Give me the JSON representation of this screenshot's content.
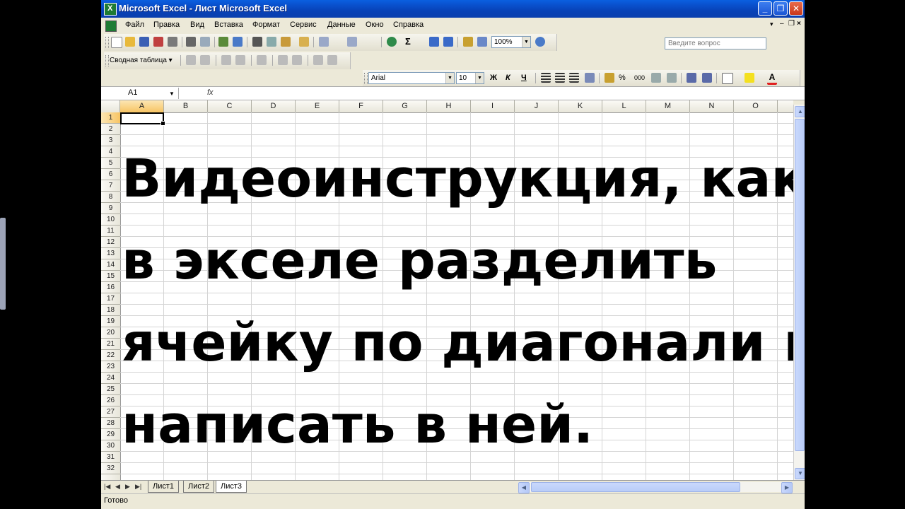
{
  "window": {
    "title": "Microsoft Excel - Лист Microsoft Excel",
    "min_label": "_",
    "max_label": "❐",
    "close_label": "✕"
  },
  "menu": {
    "items": [
      "Файл",
      "Правка",
      "Вид",
      "Вставка",
      "Формат",
      "Сервис",
      "Данные",
      "Окно",
      "Справка"
    ],
    "help_placeholder": "Введите вопрос"
  },
  "toolbar": {
    "zoom": "100%",
    "pivot_label": "Сводная таблица ▾",
    "font": "Arial",
    "font_size": "10",
    "bold": "Ж",
    "italic": "К",
    "underline": "Ч",
    "percent": "%",
    "thousands": "000",
    "sum": "Σ"
  },
  "formula_bar": {
    "name_box": "A1",
    "fx": "fx",
    "formula": ""
  },
  "sheet": {
    "columns": [
      "A",
      "B",
      "C",
      "D",
      "E",
      "F",
      "G",
      "H",
      "I",
      "J",
      "K",
      "L",
      "M",
      "N",
      "O"
    ],
    "rows": [
      "1",
      "2",
      "3",
      "4",
      "5",
      "6",
      "7",
      "8",
      "9",
      "10",
      "11",
      "12",
      "13",
      "14",
      "15",
      "16",
      "17",
      "18",
      "19",
      "20",
      "21",
      "22",
      "23",
      "24",
      "25",
      "26",
      "27",
      "28",
      "29",
      "30",
      "31",
      "32"
    ],
    "active_cell": "A1",
    "overlay_lines": [
      "Видеоинструкция, как",
      "в экселе разделить",
      "ячейку по диагонали и",
      "написать в ней."
    ]
  },
  "tabs": {
    "items": [
      "Лист1",
      "Лист2",
      "Лист3"
    ],
    "active": "Лист3"
  },
  "status": {
    "text": "Готово"
  }
}
